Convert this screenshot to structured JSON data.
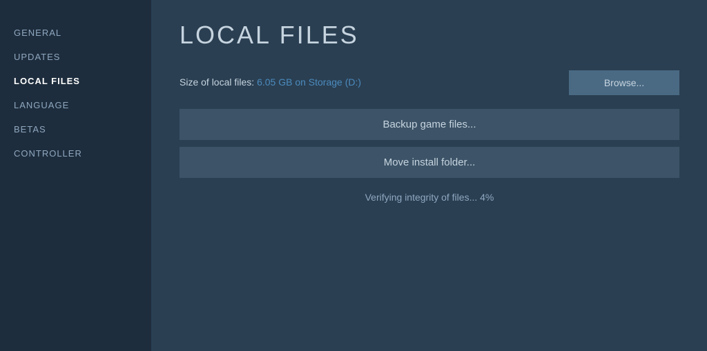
{
  "sidebar": {
    "items": [
      {
        "label": "GENERAL",
        "active": false
      },
      {
        "label": "UPDATES",
        "active": false
      },
      {
        "label": "LOCAL FILES",
        "active": true
      },
      {
        "label": "LANGUAGE",
        "active": false
      },
      {
        "label": "BETAS",
        "active": false
      },
      {
        "label": "CONTROLLER",
        "active": false
      }
    ]
  },
  "main": {
    "title": "LOCAL FILES",
    "file_size_prefix": "Size of local files: ",
    "file_size_value": "6.05 GB on Storage (D:)",
    "browse_button_label": "Browse...",
    "backup_button_label": "Backup game files...",
    "move_button_label": "Move install folder...",
    "verify_status": "Verifying integrity of files... 4%"
  },
  "colors": {
    "accent_blue": "#4b8bbe",
    "sidebar_bg": "#1e2d3d",
    "main_bg": "#2a3f52",
    "button_bg": "#3d5468",
    "browse_bg": "#4a6a84"
  }
}
